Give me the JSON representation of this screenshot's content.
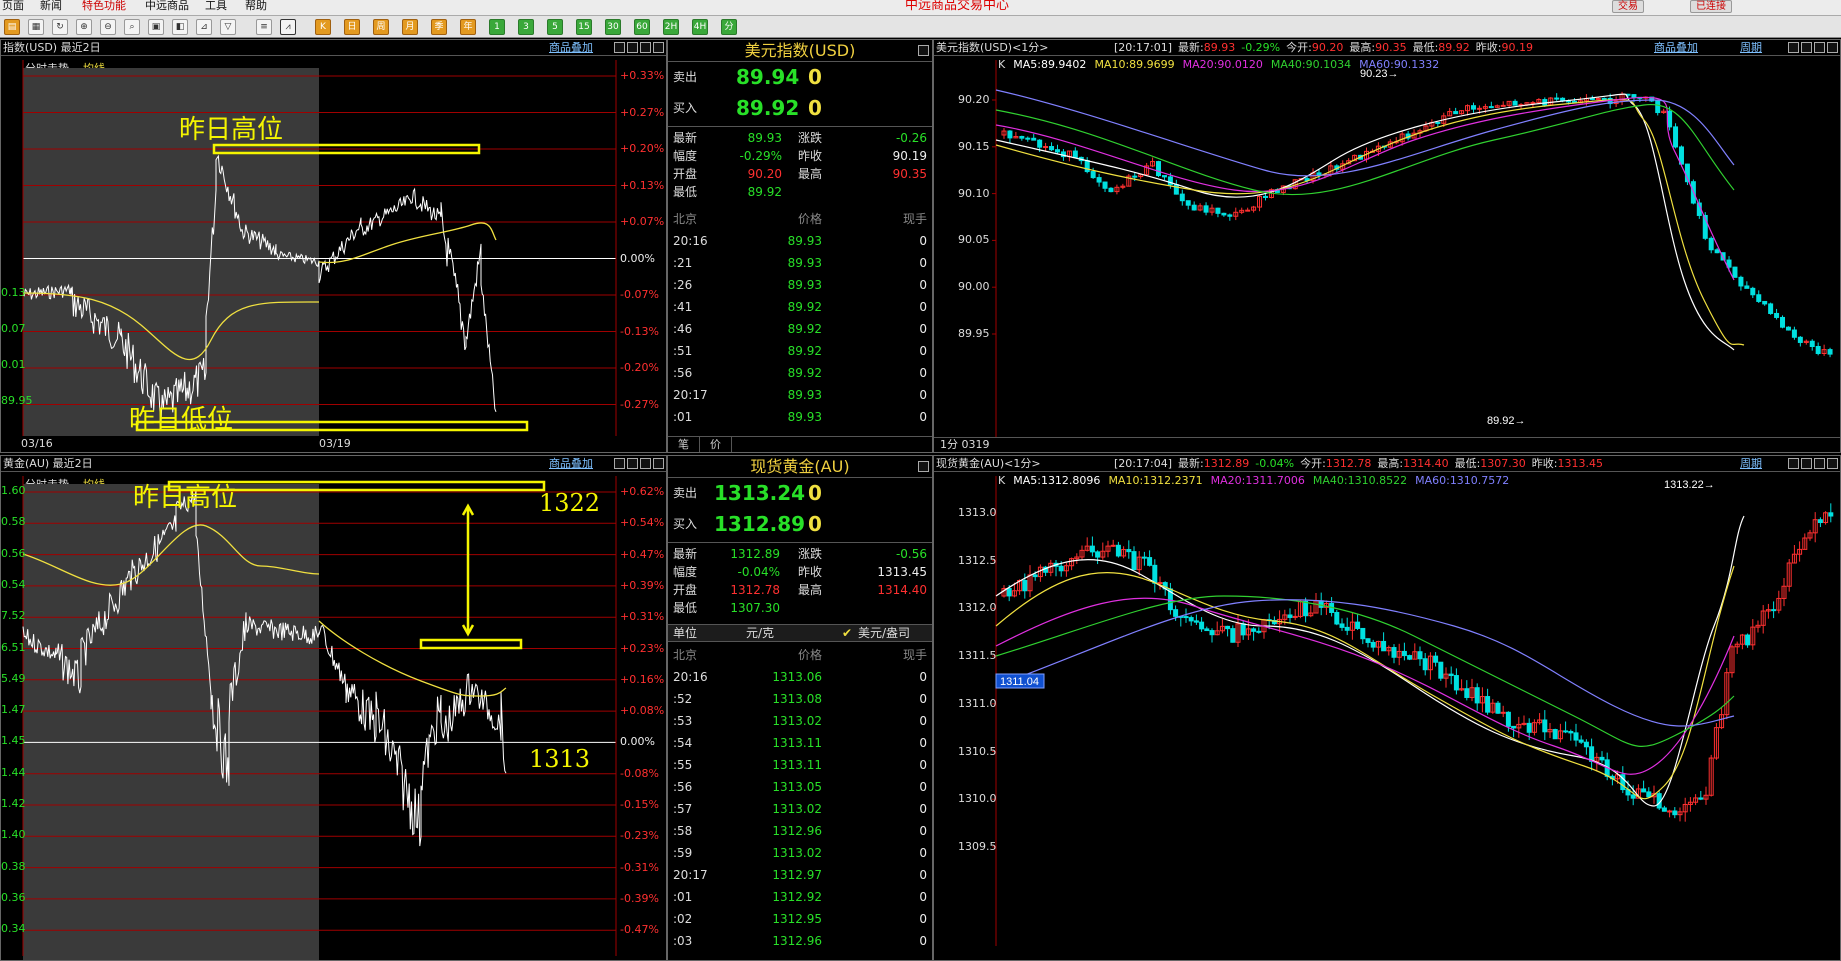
{
  "menu": {
    "items": [
      "页面",
      "新闻",
      "特色功能",
      "中远商品",
      "工具",
      "帮助"
    ],
    "center_title": "中远商品交易中心",
    "trade_btn": "交易",
    "conn_btn": "已连接"
  },
  "toolbar": {
    "buttons": [
      "K",
      "1",
      "3",
      "5",
      "15",
      "30",
      "60",
      "2H",
      "4H",
      "日",
      "周",
      "月",
      "季",
      "年",
      "分"
    ]
  },
  "usd_chart": {
    "title": "指数(USD) 最近2日",
    "overlay_link": "商品叠加",
    "legend_a": "分时走势",
    "legend_b": "均线",
    "left_ticks": [
      "0.13",
      "0.07",
      "0.01",
      "89.95"
    ],
    "right_ticks": [
      "+0.33%",
      "+0.27%",
      "+0.20%",
      "+0.13%",
      "+0.07%",
      "0.00%",
      "-0.07%",
      "-0.13%",
      "-0.20%",
      "-0.27%"
    ],
    "dates": [
      "03/16",
      "03/19"
    ],
    "annotation_high": "昨日高位",
    "annotation_low": "昨日低位"
  },
  "usd_quote": {
    "title": "美元指数(USD)",
    "sell_label": "卖出",
    "sell_price": "89.94",
    "sell_vol": "0",
    "buy_label": "买入",
    "buy_price": "89.92",
    "buy_vol": "0",
    "stats": [
      {
        "k": "最新",
        "v": "89.93",
        "k2": "涨跌",
        "v2": "-0.26"
      },
      {
        "k": "幅度",
        "v": "-0.29%",
        "k2": "昨收",
        "v2": "90.19"
      },
      {
        "k": "开盘",
        "v": "90.20",
        "k2": "最高",
        "v2": "90.35"
      },
      {
        "k": "最低",
        "v": "89.92",
        "k2": "",
        "v2": ""
      }
    ],
    "tick_header": {
      "t": "北京",
      "p": "价格",
      "v": "现手"
    },
    "ticks": [
      {
        "t": "20:16",
        "p": "89.93",
        "v": "0"
      },
      {
        "t": ":21",
        "p": "89.93",
        "v": "0"
      },
      {
        "t": ":26",
        "p": "89.93",
        "v": "0"
      },
      {
        "t": ":41",
        "p": "89.92",
        "v": "0"
      },
      {
        "t": ":46",
        "p": "89.92",
        "v": "0"
      },
      {
        "t": ":51",
        "p": "89.92",
        "v": "0"
      },
      {
        "t": ":56",
        "p": "89.92",
        "v": "0"
      },
      {
        "t": "20:17",
        "p": "89.93",
        "v": "0"
      },
      {
        "t": ":01",
        "p": "89.93",
        "v": "0"
      }
    ],
    "tab_a": "笔",
    "tab_b": "价"
  },
  "usd_k": {
    "title": "美元指数(USD)<1分>",
    "time": "[20:17:01]",
    "info": [
      {
        "k": "最新:",
        "v": "89.93"
      },
      {
        "k": "",
        "v": "-0.29%"
      },
      {
        "k": "今开:",
        "v": "90.20"
      },
      {
        "k": "最高:",
        "v": "90.35"
      },
      {
        "k": "最低:",
        "v": "89.92"
      },
      {
        "k": "昨收:",
        "v": "90.19"
      }
    ],
    "overlay_link": "商品叠加",
    "period_link": "周期",
    "ma": [
      "K",
      "MA5:89.9402",
      "MA10:89.9699",
      "MA20:90.0120",
      "MA40:90.1034",
      "MA60:90.1332"
    ],
    "ma_colors": [
      "#ddd",
      "#ffffff",
      "#f0e040",
      "#e030e0",
      "#30d030",
      "#8080ff"
    ],
    "y_ticks": [
      "90.20",
      "90.15",
      "90.10",
      "90.05",
      "90.00",
      "89.95"
    ],
    "high_mark": "90.23",
    "low_mark": "89.92",
    "footer": [
      "1分",
      "0319"
    ]
  },
  "gold_chart": {
    "title": "黄金(AU) 最近2日",
    "overlay_link": "商品叠加",
    "legend_a": "分时走势",
    "legend_b": "均线",
    "left_ticks": [
      "1.60",
      "0.58",
      "0.56",
      "0.54",
      "7.52",
      "6.51",
      "5.49",
      "1.47",
      "1.45",
      "1.44",
      "1.42",
      "1.40",
      "0.38",
      "0.36",
      "0.34"
    ],
    "right_ticks": [
      "+0.62%",
      "+0.54%",
      "+0.47%",
      "+0.39%",
      "+0.31%",
      "+0.23%",
      "+0.16%",
      "+0.08%",
      "0.00%",
      "-0.08%",
      "-0.15%",
      "-0.23%",
      "-0.31%",
      "-0.39%",
      "-0.47%"
    ],
    "annotation_high": "昨日高位",
    "level_high": "1322",
    "level_low": "1313"
  },
  "gold_quote": {
    "title": "现货黄金(AU)",
    "sell_label": "卖出",
    "sell_price": "1313.24",
    "sell_vol": "0",
    "buy_label": "买入",
    "buy_price": "1312.89",
    "buy_vol": "0",
    "stats": [
      {
        "k": "最新",
        "v": "1312.89",
        "k2": "涨跌",
        "v2": "-0.56"
      },
      {
        "k": "幅度",
        "v": "-0.04%",
        "k2": "昨收",
        "v2": "1313.45"
      },
      {
        "k": "开盘",
        "v": "1312.78",
        "k2": "最高",
        "v2": "1314.40"
      },
      {
        "k": "最低",
        "v": "1307.30",
        "k2": "",
        "v2": ""
      }
    ],
    "unit_label": "单位",
    "unit_a": "元/克",
    "unit_b": "美元/盎司",
    "tick_header": {
      "t": "北京",
      "p": "价格",
      "v": "现手"
    },
    "ticks": [
      {
        "t": "20:16",
        "p": "1313.06",
        "v": "0"
      },
      {
        "t": ":52",
        "p": "1313.08",
        "v": "0"
      },
      {
        "t": ":53",
        "p": "1313.02",
        "v": "0"
      },
      {
        "t": ":54",
        "p": "1313.11",
        "v": "0"
      },
      {
        "t": ":55",
        "p": "1313.11",
        "v": "0"
      },
      {
        "t": ":56",
        "p": "1313.05",
        "v": "0"
      },
      {
        "t": ":57",
        "p": "1313.02",
        "v": "0"
      },
      {
        "t": ":58",
        "p": "1312.96",
        "v": "0"
      },
      {
        "t": ":59",
        "p": "1313.02",
        "v": "0"
      },
      {
        "t": "20:17",
        "p": "1312.97",
        "v": "0"
      },
      {
        "t": ":01",
        "p": "1312.92",
        "v": "0"
      },
      {
        "t": ":02",
        "p": "1312.95",
        "v": "0"
      },
      {
        "t": ":03",
        "p": "1312.96",
        "v": "0"
      }
    ]
  },
  "gold_k": {
    "title": "现货黄金(AU)<1分>",
    "time": "[20:17:04]",
    "info": [
      {
        "k": "最新:",
        "v": "1312.89"
      },
      {
        "k": "",
        "v": "-0.04%"
      },
      {
        "k": "今开:",
        "v": "1312.78"
      },
      {
        "k": "最高:",
        "v": "1314.40"
      },
      {
        "k": "最低:",
        "v": "1307.30"
      },
      {
        "k": "昨收:",
        "v": "1313.45"
      }
    ],
    "period_link": "周期",
    "ma": [
      "K",
      "MA5:1312.8096",
      "MA10:1312.2371",
      "MA20:1311.7006",
      "MA40:1310.8522",
      "MA60:1310.7572"
    ],
    "ma_colors": [
      "#ddd",
      "#ffffff",
      "#f0e040",
      "#e030e0",
      "#30d030",
      "#8080ff"
    ],
    "y_ticks": [
      "1313.0",
      "1312.5",
      "1312.0",
      "1311.5",
      "1311.0",
      "1310.5",
      "1310.0",
      "1309.5"
    ],
    "high_mark": "1313.22",
    "cursor_label": "1311.04"
  },
  "colors": {
    "up": "#ff3030",
    "down": "#00e0e0",
    "green": "#28e028",
    "yellow": "#f5f500",
    "grid": "#a00000"
  }
}
